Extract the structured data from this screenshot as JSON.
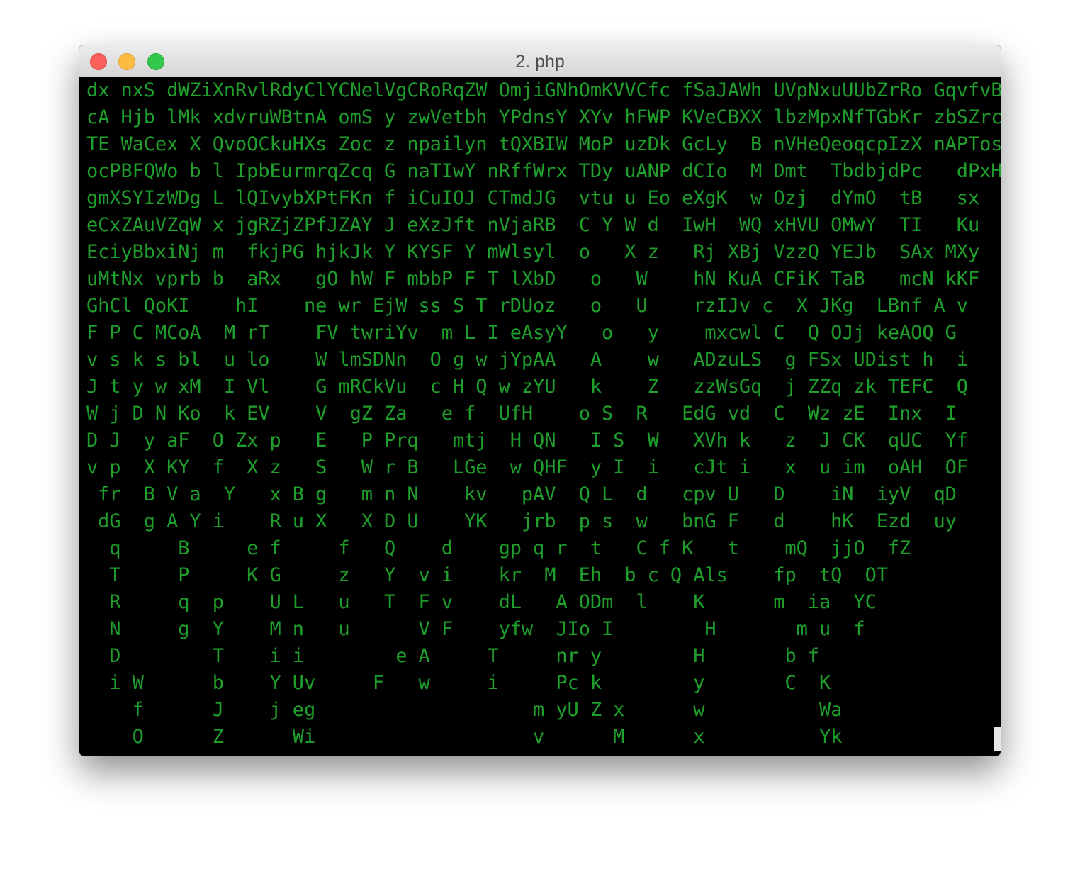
{
  "window": {
    "title": "2. php",
    "controls": [
      "close",
      "minimize",
      "zoom"
    ],
    "colors": {
      "close": "#fc605c",
      "minimize": "#fdbc40",
      "zoom": "#34c84a"
    }
  },
  "terminal": {
    "background": "#000000",
    "foreground": "#1f9e2c",
    "highlight": "#ffffff",
    "text": "dx nxS dWZiXnRvlRdyClYCNelVgCRoRqZW OmjiGNhOmKVVCfc fSaJAWh UVpNxuUUbZrRo GqvfvB\ncA Hjb lMk xdvruWBtnA omS y zwVetbh YPdnsY XYv hFWP KVeCBXX lbzMpxNfTGbKr zbSZrc\nTE WaCex X QvoOCkuHXs Zoc z npailyn tQXBIW MoP uzDk GcLy  B nVHeQeoqcpIzX nAPTos\nocPBFQWo b l IpbEurmrqZcq G naTIwY nRffWrx TDy uANP dCIo  M Dmt  TbdbjdPc   dPxH\ngmXSYIzWDg L lQIvybXPtFKn f iCuIOJ CTmdJG  vtu u Eo eXgK  w Ozj  dYmO  tB   sx\neCxZAuVZqW x jgRZjZPfJZAY J eXzJft nVjaRB  C Y W d  IwH  WQ xHVU OMwY  TI   Ku\nEciyBbxiNj m  fkjPG hjkJk Y KYSF Y mWlsyl  o   X z   Rj XBj VzzQ YEJb  SAx MXy\nuMtNx vprb b  aRx   gO hW F mbbP F T lXbD   o   W    hN KuA CFiK TaB   mcN kKF\nGhCl QoKI    hI    ne wr EjW ss S T rDUoz   o   U    rzIJv c  X JKg  LBnf A v\nF P C MCoA  M rT    FV twriYv  m L I eAsyY   o   y    mxcwl C  Q OJj keAOQ G\nv s k s bl  u lo    W lmSDNn  O g w jYpAA   A    w   ADzuLS  g FSx UDist h  i\nJ t y w xM  I Vl    G mRCkVu  c H Q w zYU   k    Z   zzWsGq  j ZZq zk TEFC  Q\nW j D N Ko  k EV    V  gZ Za   e f  UfH    o S  R   EdG vd  C  Wz zE  Inx  I\nD J  y aF  O Zx p   E   P Prq   mtj  H QN   I S  W   XVh k   z  J CK  qUC  Yf\nv p  X KY  f  X z   S   W r B   LGe  w QHF  y I  i   cJt i   x  u im  oAH  OF\n fr  B V a  Y   x B g   m n N    kv   pAV  Q L  d   cpv U   D    iN  iyV  qD\n dG  g A Y i    R u X   X D U    YK   jrb  p s  w   bnG F   d    hK  Ezd  uy\n  q     B     e f     f   Q    d    gp q r  t   C f K   t    mQ  jjO  fZ\n  T     P     K G     z   Y  v i    kr  M  Eh  b c Q Als    fp  tQ  OT\n  R     q  p    U L   u   T  F v    dL   A ODm  l    K      m  ia  YC\n  N     g  Y    M n   u      V F    yfw  JIo I        H       m u  f\n  D        T    i i        e A     T     nr y        H       b f\n  i W      b    Y Uv     F   w     i     Pc k        y       C  K\n    f      J    j eg                   m yU Z x      w          Wa\n    O      Z      Wi                   v      M      x          Yk"
  }
}
